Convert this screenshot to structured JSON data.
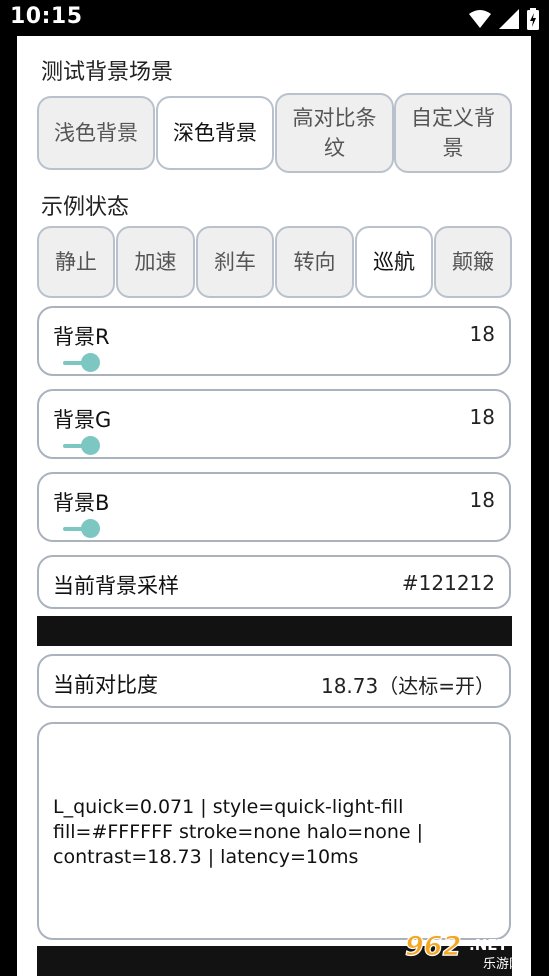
{
  "status_bar": {
    "time": "10:15"
  },
  "background_scene": {
    "title": "测试背景场景",
    "options": [
      {
        "label": "浅色背景",
        "active": false
      },
      {
        "label": "深色背景",
        "active": true
      },
      {
        "label": "高对比条纹",
        "line1": "高对比条",
        "line2": "纹",
        "active": false
      },
      {
        "label": "自定义背景",
        "line1": "自定义背",
        "line2": "景",
        "active": false
      }
    ]
  },
  "sample_state": {
    "title": "示例状态",
    "options": [
      {
        "label": "静止",
        "active": false
      },
      {
        "label": "加速",
        "active": false
      },
      {
        "label": "刹车",
        "active": false
      },
      {
        "label": "转向",
        "active": false
      },
      {
        "label": "巡航",
        "active": true
      },
      {
        "label": "颠簸",
        "active": false
      }
    ]
  },
  "sliders": [
    {
      "label": "背景R",
      "value": "18",
      "fraction": 0.07
    },
    {
      "label": "背景G",
      "value": "18",
      "fraction": 0.07
    },
    {
      "label": "背景B",
      "value": "18",
      "fraction": 0.07
    }
  ],
  "current_sample": {
    "label": "当前背景采样",
    "value": "#121212",
    "swatch_color": "#121212"
  },
  "contrast": {
    "label": "当前对比度",
    "value": "18.73（达标=开）"
  },
  "log": {
    "line1": "L_quick=0.071 | style=quick-light-fill",
    "line2": "fill=#FFFFFF stroke=none halo=none |",
    "line3": "contrast=18.73 | latency=10ms"
  },
  "watermark": {
    "text": "962.NET",
    "subtext": "乐游网"
  },
  "colors": {
    "accent": "#7cc7c1",
    "border": "#aab3bd",
    "segment_bg": "#efefef"
  }
}
